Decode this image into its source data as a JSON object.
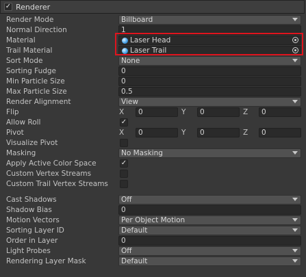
{
  "header": {
    "title": "Renderer",
    "checked_glyph": "✓"
  },
  "labels": {
    "render_mode": "Render Mode",
    "normal_direction": "Normal Direction",
    "material": "Material",
    "trail_material": "Trail Material",
    "sort_mode": "Sort Mode",
    "sorting_fudge": "Sorting Fudge",
    "min_particle_size": "Min Particle Size",
    "max_particle_size": "Max Particle Size",
    "render_alignment": "Render Alignment",
    "flip": "Flip",
    "allow_roll": "Allow Roll",
    "pivot": "Pivot",
    "visualize_pivot": "Visualize Pivot",
    "masking": "Masking",
    "apply_active_color_space": "Apply Active Color Space",
    "custom_vertex_streams": "Custom Vertex Streams",
    "custom_trail_vertex_streams": "Custom Trail Vertex Streams",
    "cast_shadows": "Cast Shadows",
    "shadow_bias": "Shadow Bias",
    "motion_vectors": "Motion Vectors",
    "sorting_layer_id": "Sorting Layer ID",
    "order_in_layer": "Order in Layer",
    "light_probes": "Light Probes",
    "rendering_layer_mask": "Rendering Layer Mask"
  },
  "values": {
    "render_mode": "Billboard",
    "normal_direction": "1",
    "material": "Laser Head",
    "trail_material": "Laser Trail",
    "sort_mode": "None",
    "sorting_fudge": "0",
    "min_particle_size": "0",
    "max_particle_size": "0.5",
    "render_alignment": "View",
    "flip": {
      "x": "0",
      "y": "0",
      "z": "0"
    },
    "pivot": {
      "x": "0",
      "y": "0",
      "z": "0"
    },
    "masking": "No Masking",
    "cast_shadows": "Off",
    "shadow_bias": "0",
    "motion_vectors": "Per Object Motion",
    "sorting_layer_id": "Default",
    "order_in_layer": "0",
    "light_probes": "Off",
    "rendering_layer_mask": "Default"
  },
  "toggles": {
    "allow_roll": true,
    "visualize_pivot": false,
    "apply_active_color_space": true,
    "custom_vertex_streams": false,
    "custom_trail_vertex_streams": false,
    "checked_glyph": "✓"
  },
  "axes": {
    "x": "X",
    "y": "Y",
    "z": "Z"
  },
  "colors": {
    "highlight": "#e0141e",
    "panel_bg": "#383838",
    "field_bg": "#2a2a2a",
    "dropdown_bg": "#515151"
  },
  "icons": {
    "material": "material-sphere-icon",
    "picker": "object-picker-icon"
  }
}
